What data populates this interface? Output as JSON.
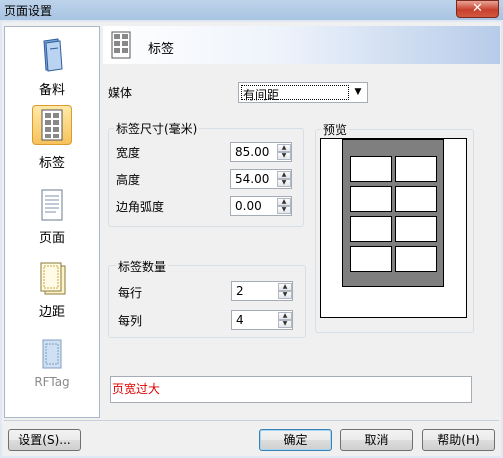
{
  "window": {
    "title": "页面设置",
    "close": "✕"
  },
  "sidebar": {
    "items": [
      {
        "label": "备料",
        "icon": "book-icon",
        "selected": false
      },
      {
        "label": "标签",
        "icon": "label-sheet-icon",
        "selected": true
      },
      {
        "label": "页面",
        "icon": "page-icon",
        "selected": false
      },
      {
        "label": "边距",
        "icon": "margins-icon",
        "selected": false
      },
      {
        "label": "RFTag",
        "icon": "rftag-icon",
        "selected": false,
        "disabled": true
      }
    ]
  },
  "header": {
    "title": "标签"
  },
  "media": {
    "label": "媒体",
    "value": "有间距"
  },
  "label_size": {
    "legend": "标签尺寸(毫米)",
    "width_label": "宽度",
    "width_value": "85.00",
    "height_label": "高度",
    "height_value": "54.00",
    "radius_label": "边角弧度",
    "radius_value": "0.00"
  },
  "label_count": {
    "legend": "标签数量",
    "per_row_label": "每行",
    "per_row_value": "2",
    "per_col_label": "每列",
    "per_col_value": "4"
  },
  "preview": {
    "legend": "预览"
  },
  "error": {
    "text": "页宽过大",
    "color": "#e00000"
  },
  "buttons": {
    "settings": "设置(S)...",
    "ok": "确定",
    "cancel": "取消",
    "help": "帮助(H)"
  }
}
